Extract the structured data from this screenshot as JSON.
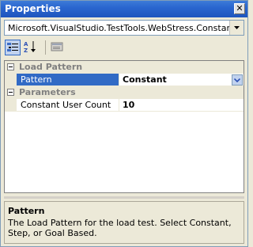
{
  "window": {
    "title": "Properties",
    "close_label": "✕"
  },
  "selector": {
    "value": "Microsoft.VisualStudio.TestTools.WebStress.ConstantLoad"
  },
  "toolbar": {
    "buttons": [
      {
        "name": "categorized",
        "icon": "categorized-icon"
      },
      {
        "name": "alphabetical",
        "icon": "sort-az-icon"
      },
      {
        "name": "property-pages",
        "icon": "property-pages-icon"
      }
    ]
  },
  "grid": {
    "categories": [
      {
        "label": "Load Pattern",
        "rows": [
          {
            "name": "Pattern",
            "value": "Constant",
            "selected": true
          }
        ]
      },
      {
        "label": "Parameters",
        "rows": [
          {
            "name": "Constant User Count",
            "value": "10",
            "selected": false
          }
        ]
      }
    ]
  },
  "description": {
    "title": "Pattern",
    "text": "The Load Pattern for the load test. Select Constant, Step, or Goal  Based."
  },
  "colors": {
    "titlebar": "#2a66cf",
    "selection": "#316ac5",
    "panel": "#ece9d8"
  }
}
